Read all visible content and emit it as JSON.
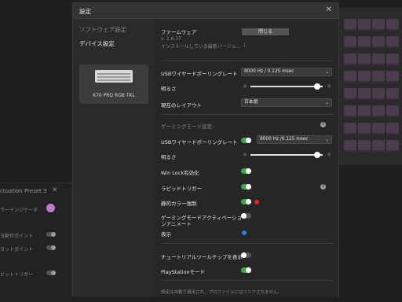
{
  "background": {
    "panel_title": "ctuation Preset 3",
    "row1": "ラーインジケータ",
    "row2": "ヨ動作ポイント",
    "row3": "ヨットポイント",
    "row4": "ピットトリガー"
  },
  "modal": {
    "title": "設定",
    "close_icon": "close-icon"
  },
  "nav": {
    "software_settings": "ソフトウェア設定",
    "device_settings": "デバイス設定",
    "device_name": "K70 PRO RGB TKL"
  },
  "firmware": {
    "label": "ファームウェア",
    "version": "v. 1.6.37",
    "install_text": "インストールしている最新バージョ...",
    "close_button": "閉じる"
  },
  "usb_polling": {
    "label": "USBワイヤードポーリングレート",
    "value": "8000 Hz / 0.125 msec"
  },
  "brightness": {
    "label": "明るさ",
    "level": 0.97
  },
  "layout": {
    "label": "現在のレイアウト",
    "value": "日本語"
  },
  "gaming": {
    "section_label": "ゲーミングモード設定:",
    "usb_polling_label": "USBワイヤードポーリングレート",
    "usb_polling_value": "8000 Hz /0.125 msec",
    "brightness_label": "明るさ",
    "brightness_level": 0.97,
    "winlock_label": "Win Lock有効化",
    "rapid_trigger_label": "ラピッドトリガー",
    "static_color_label": "静的カラー強制",
    "static_color": "#e0242a",
    "anim_label_1": "ゲーミングモードアクティベーショ",
    "anim_label_2": "ンアニメート",
    "display_label": "表示",
    "display_color": "#2a7fe0"
  },
  "tutorial_label": "チュートリアルツールチップを表示",
  "playstation_label": "PlayStationモード",
  "footer": "設定は自動で適用され、プロファイルにはリンクされません。",
  "colors": {
    "accent_green": "#3aa84d"
  }
}
